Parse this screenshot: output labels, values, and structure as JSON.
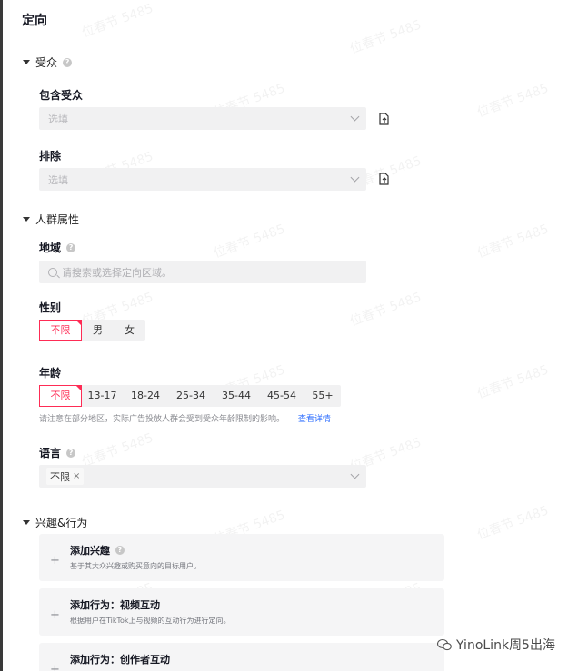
{
  "page_title": "定向",
  "audience": {
    "section_label": "受众",
    "include": {
      "label": "包含受众",
      "placeholder": "选填"
    },
    "exclude": {
      "label": "排除",
      "placeholder": "选填"
    }
  },
  "demographics": {
    "section_label": "人群属性",
    "region": {
      "label": "地域",
      "placeholder": "请搜索或选择定向区域。"
    },
    "gender": {
      "label": "性别",
      "options": [
        "不限",
        "男",
        "女"
      ],
      "selected": "不限"
    },
    "age": {
      "label": "年龄",
      "options": [
        "不限",
        "13-17",
        "18-24",
        "25-34",
        "35-44",
        "45-54",
        "55+"
      ],
      "selected": "不限",
      "hint": "请注意在部分地区，实际广告投放人群会受到受众年龄限制的影响。",
      "hint_link": "查看详情"
    },
    "language": {
      "label": "语言",
      "tag": "不限",
      "tag_remove": "×"
    }
  },
  "interests": {
    "section_label": "兴趣&行为",
    "cards": [
      {
        "title": "添加兴趣",
        "desc": "基于其大众兴趣或购买意向的目标用户。"
      },
      {
        "title": "添加行为：视频互动",
        "desc": "根据用户在TikTok上与视频的互动行为进行定向。"
      },
      {
        "title": "添加行为：创作者互动",
        "desc": ""
      }
    ],
    "plus_symbol": "+"
  },
  "help_symbol": "?",
  "watermark_text": "位春节 5485",
  "footer_brand": "YinoLink周5出海",
  "colors": {
    "accent": "#fe2c55",
    "link": "#2f6fff",
    "input_bg": "#f1f1f2"
  },
  "icons": [
    "caret-down-icon",
    "help-icon",
    "chevron-down-icon",
    "upload-file-icon",
    "search-icon",
    "plus-icon",
    "wechat-logo-icon"
  ]
}
